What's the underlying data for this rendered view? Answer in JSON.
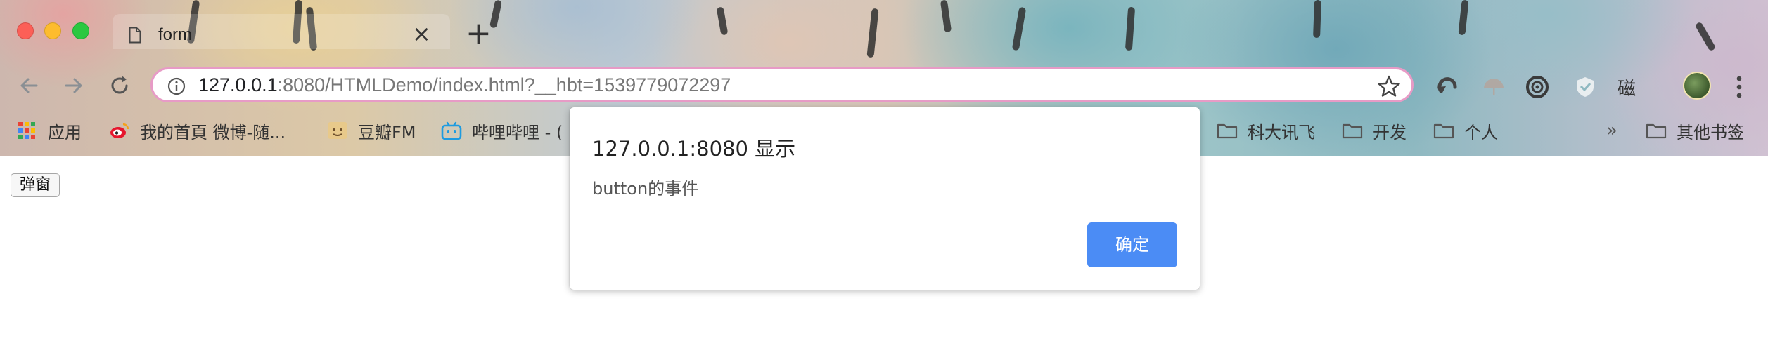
{
  "tab": {
    "title": "form",
    "close_symbol": "×",
    "new_tab_symbol": "+"
  },
  "omnibox": {
    "url_host": "127.0.0.1",
    "url_rest": ":8080/HTMLDemo/index.html?__hbt=1539779072297"
  },
  "extensions": {
    "text_label": "磁"
  },
  "bookmarks": {
    "items": [
      {
        "label": "应用",
        "icon": "apps-grid-icon"
      },
      {
        "label": "我的首頁 微博-随...",
        "icon": "weibo-icon"
      },
      {
        "label": "豆瓣FM",
        "icon": "douban-fm-icon"
      },
      {
        "label": "哔哩哔哩 - (",
        "icon": "bilibili-icon"
      },
      {
        "label": "科大讯飞",
        "icon": "folder-icon"
      },
      {
        "label": "开发",
        "icon": "folder-icon"
      },
      {
        "label": "个人",
        "icon": "folder-icon"
      },
      {
        "label": "其他书签",
        "icon": "folder-icon"
      }
    ],
    "overflow_symbol": "»"
  },
  "page": {
    "button_label": "弹窗"
  },
  "dialog": {
    "title": "127.0.0.1:8080 显示",
    "message": "button的事件",
    "ok_label": "确定"
  },
  "colors": {
    "omnibox_border": "#e79bc6",
    "dialog_button": "#4b8cf5",
    "traffic_close": "#fc5f57",
    "traffic_minimize": "#fdbc2e",
    "traffic_zoom": "#2bc840"
  }
}
